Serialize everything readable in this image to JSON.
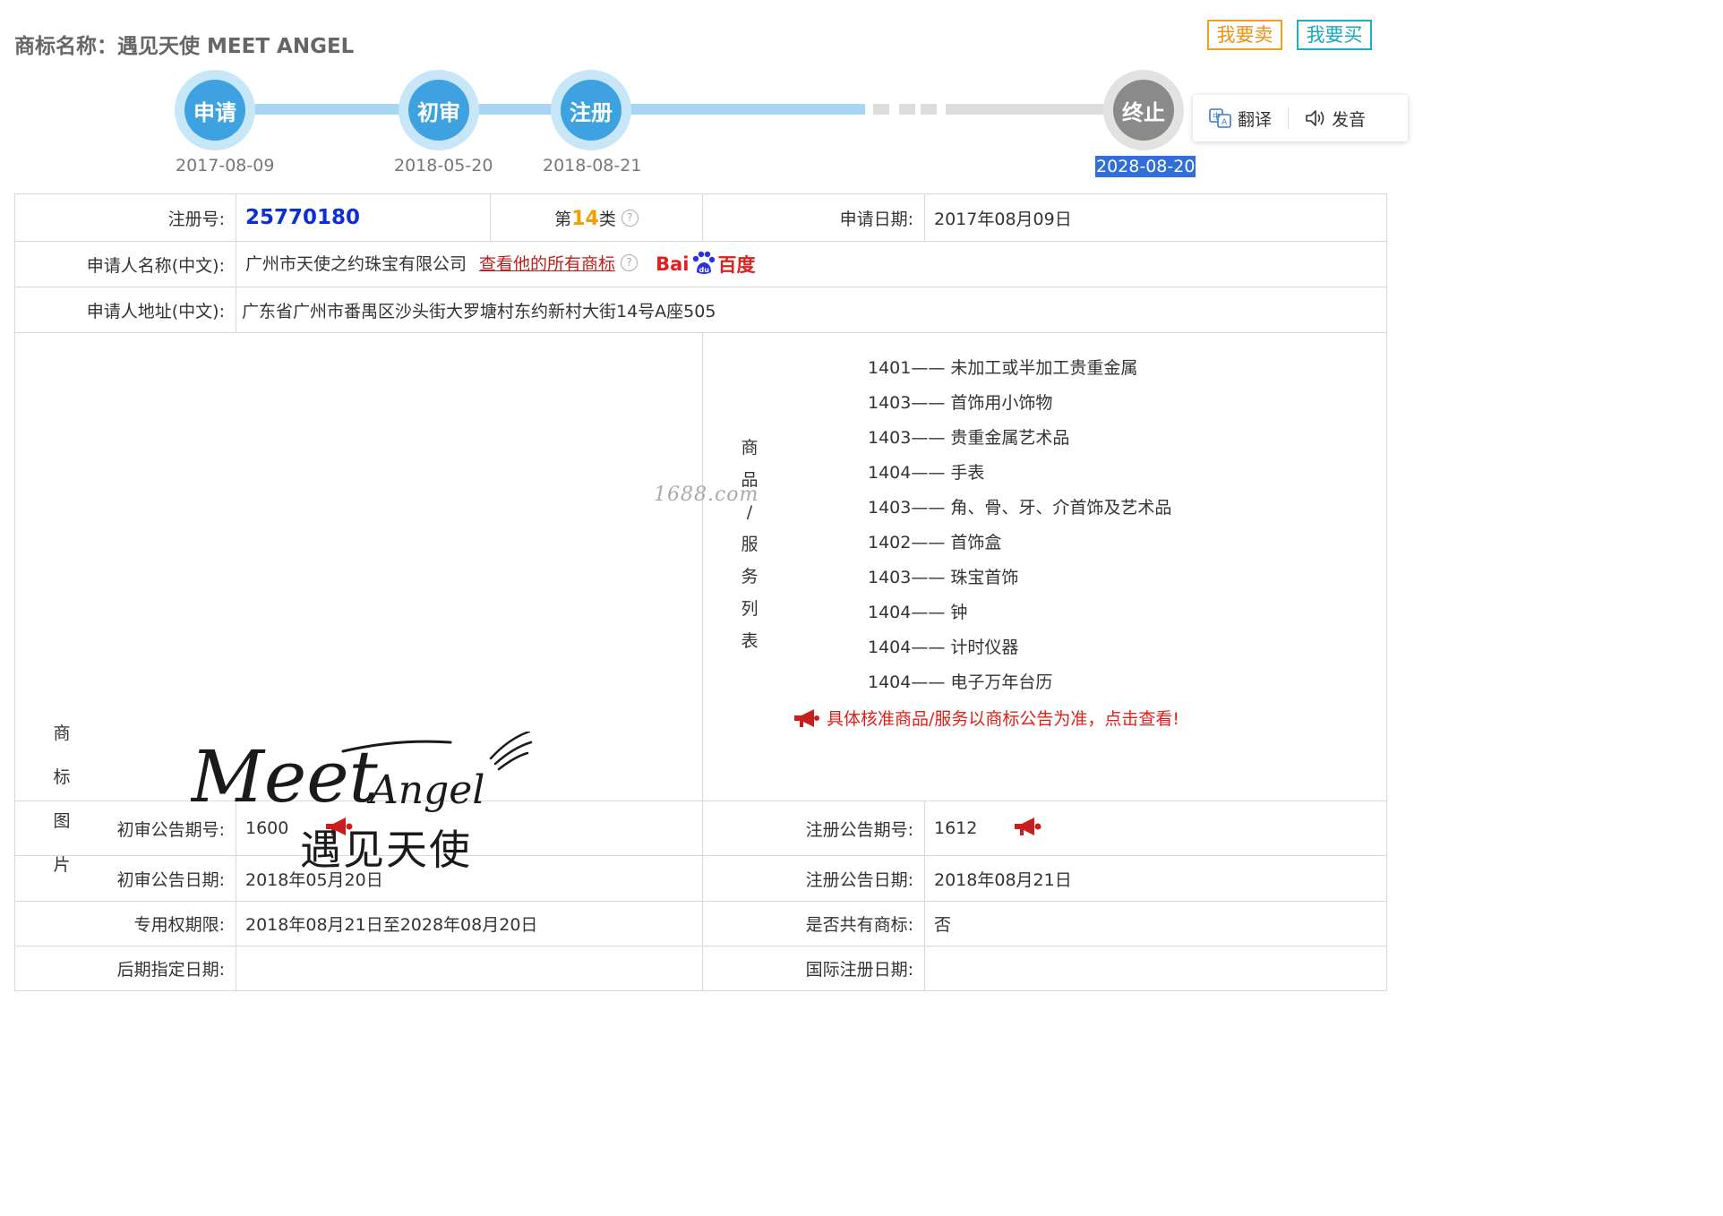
{
  "page": {
    "title": "商标名称：遇见天使 MEET ANGEL",
    "sell_button": "我要卖",
    "buy_button": "我要买"
  },
  "timeline": {
    "steps": [
      {
        "label": "申请",
        "date": "2017-08-09"
      },
      {
        "label": "初审",
        "date": "2018-05-20"
      },
      {
        "label": "注册",
        "date": "2018-08-21"
      },
      {
        "label": "终止",
        "date": "2028-08-20"
      }
    ]
  },
  "popup": {
    "translate": "翻译",
    "speak": "发音"
  },
  "info": {
    "reg_no_label": "注册号:",
    "reg_no": "25770180",
    "class_prefix": "第",
    "class_num": "14",
    "class_suffix": "类",
    "apply_date_label": "申请日期:",
    "apply_date": "2017年08月09日",
    "applicant_label": "申请人名称(中文):",
    "applicant": "广州市天使之约珠宝有限公司",
    "view_all_link": "查看他的所有商标",
    "baidu_text_1": "Bai",
    "baidu_text_2": "百度",
    "address_label": "申请人地址(中文):",
    "address": "广东省广州市番禺区沙头街大罗塘村东约新村大街14号A座505"
  },
  "logo": {
    "side_label": [
      "商",
      "标",
      "图",
      "片"
    ],
    "script_text": "Meet",
    "script_text_2": "Angel",
    "cn_text": "遇见天使"
  },
  "goods": {
    "side_label": [
      "商",
      "品",
      "/",
      "服",
      "务",
      "列",
      "表"
    ],
    "items": [
      "1401—— 未加工或半加工贵重金属",
      "1403—— 首饰用小饰物",
      "1403—— 贵重金属艺术品",
      "1404—— 手表",
      "1403—— 角、骨、牙、介首饰及艺术品",
      "1402—— 首饰盒",
      "1403—— 珠宝首饰",
      "1404—— 钟",
      "1404—— 计时仪器",
      "1404—— 电子万年台历"
    ],
    "notice": "具体核准商品/服务以商标公告为准，点击查看!",
    "watermark": "1688.com"
  },
  "bulletin": {
    "prelim_no_label": "初审公告期号:",
    "prelim_no": "1600",
    "reg_no_label": "注册公告期号:",
    "reg_no": "1612",
    "prelim_date_label": "初审公告日期:",
    "prelim_date": "2018年05月20日",
    "reg_date_label": "注册公告日期:",
    "reg_date": "2018年08月21日",
    "term_label": "专用权期限:",
    "term": "2018年08月21日至2028年08月20日",
    "shared_label": "是否共有商标:",
    "shared": "否",
    "later_label": "后期指定日期:",
    "later": "",
    "intl_label": "国际注册日期:",
    "intl": ""
  }
}
